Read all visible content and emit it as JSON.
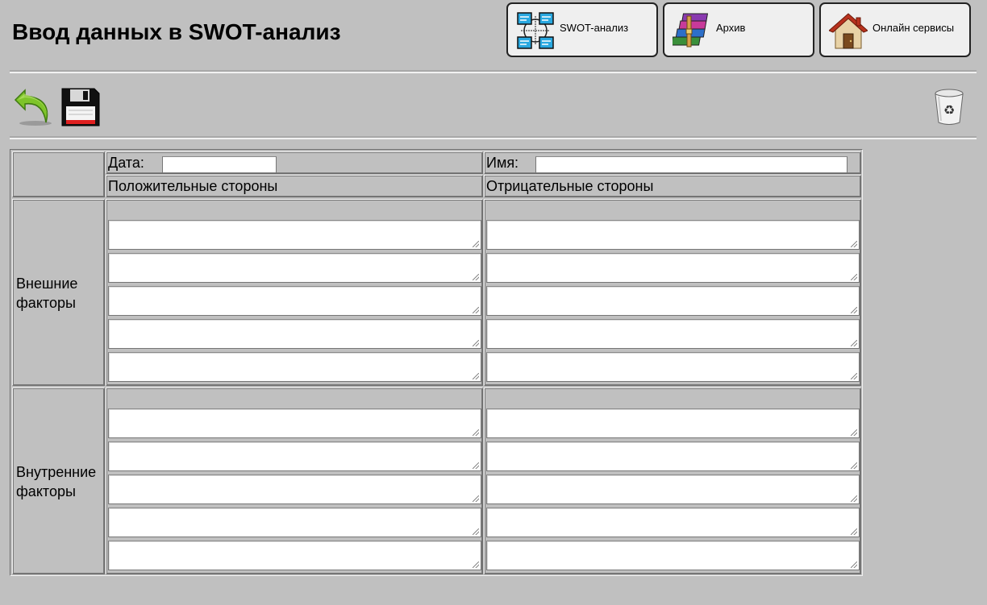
{
  "header": {
    "title": "Ввод данных в SWOT-анализ"
  },
  "nav": {
    "swot_label": "SWOT-анализ",
    "archive_label": "Архив",
    "online_label": "Онлайн сервисы"
  },
  "toolbar": {
    "back_icon": "undo-arrow-icon",
    "save_icon": "floppy-disk-icon",
    "trash_icon": "recycle-bin-icon"
  },
  "form": {
    "date_label": "Дата:",
    "date_value": "",
    "name_label": "Имя:",
    "name_value": "",
    "positive_header": "Положительные стороны",
    "negative_header": "Отрицательные стороны",
    "external_label": [
      "Внешние",
      "факторы"
    ],
    "internal_label": [
      "Внутренние",
      "факторы"
    ],
    "external_positive": [
      "",
      "",
      "",
      "",
      ""
    ],
    "external_negative": [
      "",
      "",
      "",
      "",
      ""
    ],
    "internal_positive": [
      "",
      "",
      "",
      "",
      ""
    ],
    "internal_negative": [
      "",
      "",
      "",
      "",
      ""
    ]
  },
  "colors": {
    "background": "#c0c0c0",
    "button_face": "#efefef"
  }
}
